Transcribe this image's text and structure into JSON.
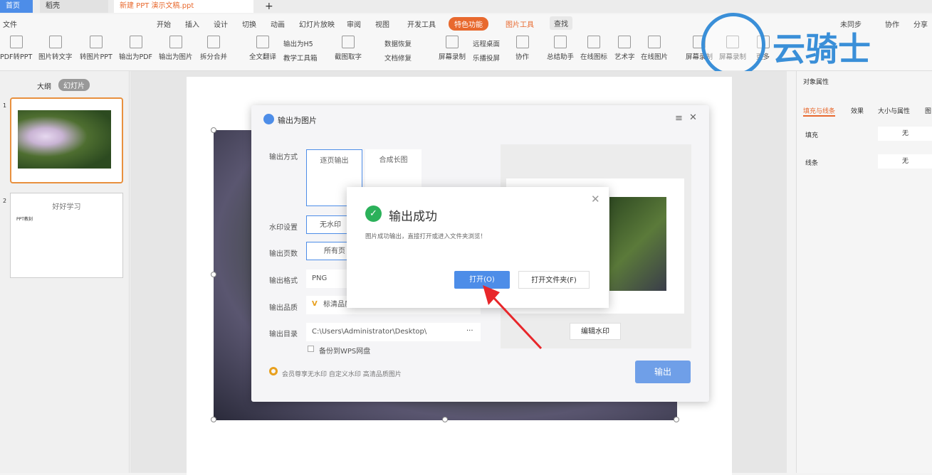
{
  "tabs": {
    "home": "首页",
    "daoke": "稻壳",
    "doc": "新建 PPT 演示文稿.ppt",
    "new": "+"
  },
  "menu": {
    "file": "文件",
    "items": [
      "开始",
      "插入",
      "设计",
      "切换",
      "动画",
      "幻灯片放映",
      "审阅",
      "视图",
      "开发工具"
    ],
    "special": "特色功能",
    "picture_tools": "图片工具",
    "search": "查找",
    "sync": "未同步",
    "collab": "协作",
    "share": "分享"
  },
  "toolbar": [
    "PDF转PPT",
    "图片转文字",
    "转图片PPT",
    "输出为PDF",
    "输出为图片",
    "拆分合并",
    "全文翻译",
    "输出为H5",
    "教学工具箱",
    "截图取字",
    "数据恢复",
    "文档修复",
    "屏幕录制",
    "远程桌面",
    "乐播投屏",
    "协作",
    "总结助手",
    "在线图标",
    "艺术字",
    "在线图片",
    "屏幕录制",
    "屏幕录制",
    "更多"
  ],
  "watermark_logo": "云骑士",
  "left_panel": {
    "outline": "大纲",
    "slides": "幻灯片",
    "slide1_num": "1",
    "slide2_num": "2",
    "slide2_title": "好好学习",
    "slide2_bullet": "PPT教刻"
  },
  "dialog": {
    "title": "输出为图片",
    "mode_label": "输出方式",
    "mode_page": "逐页输出",
    "mode_long": "合成长图",
    "watermark_label": "水印设置",
    "watermark_value": "无水印",
    "pages_label": "输出页数",
    "pages_value": "所有页",
    "format_label": "输出格式",
    "format_value": "PNG",
    "quality_label": "输出品质",
    "quality_value": "标清品质",
    "dir_label": "输出目录",
    "dir_value": "C:\\Users\\Administrator\\Desktop\\",
    "dir_more": "···",
    "backup": "备份到WPS网盘",
    "vip_text": "会员尊享无水印  自定义水印  高清品质图片",
    "edit_watermark": "编辑水印",
    "export": "输出"
  },
  "popup": {
    "title": "输出成功",
    "message": "图片成功输出，直接打开或进入文件夹浏览！",
    "open": "打开(O)",
    "open_folder": "打开文件夹(F)"
  },
  "right_panel": {
    "title": "对象属性",
    "tabs": [
      "填充与线条",
      "效果",
      "大小与属性",
      "图"
    ],
    "fill_label": "填充",
    "fill_value": "无",
    "line_label": "线条",
    "line_value": "无"
  },
  "colors": {
    "accent": "#e8692e",
    "primary": "#4d8de8",
    "success": "#2bb15a"
  }
}
